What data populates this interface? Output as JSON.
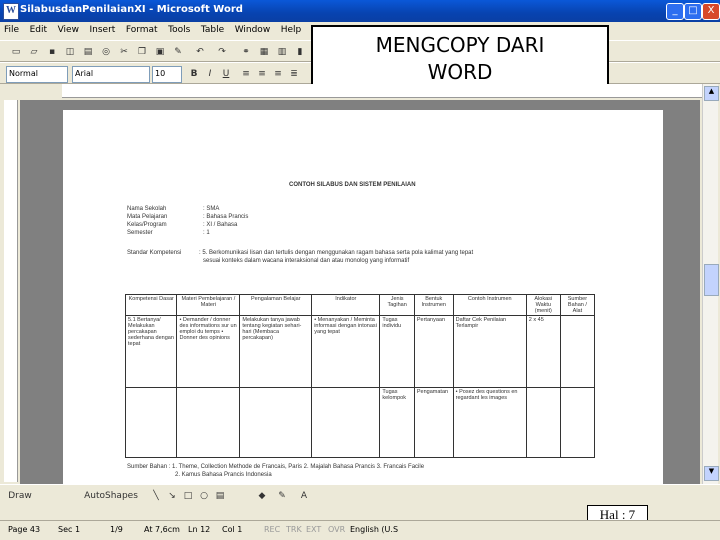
{
  "window": {
    "title": "SilabusdanPenilaianXI - Microsoft Word",
    "app_icon": "W"
  },
  "window_buttons": {
    "minimize": "_",
    "maximize": "□",
    "close": "X"
  },
  "menu": [
    "File",
    "Edit",
    "View",
    "Insert",
    "Format",
    "Tools",
    "Table",
    "Window",
    "Help"
  ],
  "formatting": {
    "style": "Normal",
    "font": "Arial",
    "size": "10",
    "bold": "B",
    "italic": "I",
    "underline": "U"
  },
  "callout": {
    "line1": "MENGCOPY DARI",
    "line2": "WORD"
  },
  "document": {
    "heading": "CONTOH SILABUS DAN SISTEM PENILAIAN",
    "meta": [
      {
        "label": "Nama Sekolah",
        "value": ": SMA"
      },
      {
        "label": "Mata Pelajaran",
        "value": ": Bahasa Prancis"
      },
      {
        "label": "Kelas/Program",
        "value": ": XI / Bahasa"
      },
      {
        "label": "Semester",
        "value": ": 1"
      }
    ],
    "sk_label": "Standar Kompetensi",
    "sk_text": ": 5. Berkomunikasi lisan dan tertulis dengan menggunakan ragam bahasa serta pola kalimat yang tepat",
    "sk_text2": "sesuai konteks dalam wacana interaksional dan atau monolog yang informatif",
    "columns": [
      "Kompetensi Dasar",
      "Materi Pembelajaran / Materi",
      "Pengalaman Belajar",
      "Indikator",
      "Jenis Tagihan",
      "Bentuk Instrumen",
      "Contoh Instrumen",
      "Alokasi Waktu (menit)",
      "Sumber Bahan / Alat"
    ],
    "row": {
      "kd": "5.1 Bertanya/ Melakukan percakapan sederhana dengan tepat",
      "materi": "• Demander / donner des informations sur un emploi du temps • Donner des opinions",
      "pengalaman": "Melakukan tanya jawab tentang kegiatan sehari-hari (Membaca percakapan)",
      "indikator": "• Menanyakan / Meminta informasi dengan intonasi yang tepat",
      "jenis": "Tugas individu",
      "bentuk": "Pertanyaan",
      "contoh": "Daftar Cek Penilaian Terlampir",
      "waktu": "2 x 45",
      "sumber": ""
    },
    "row2": {
      "jenis": "Tugas kelompok",
      "bentuk": "Pengamatan",
      "contoh": "• Posez des questions en regardant les images"
    },
    "footer_line1": "Sumber Bahan : 1. Theme, Collection Methode de Francais, Paris 2. Majalah Bahasa Prancis 3. Francais Facile",
    "footer_line2": "2. Kamus Bahasa Prancis Indonesia"
  },
  "drawing": {
    "draw": "Draw",
    "autoshapes": "AutoShapes"
  },
  "status": {
    "page": "Page 43",
    "sec": "Sec 1",
    "pages": "1/9",
    "at": "At 7,6cm",
    "ln": "Ln 12",
    "col": "Col 1",
    "rec": "REC",
    "trk": "TRK",
    "ext": "EXT",
    "ovr": "OVR",
    "lang": "English (U.S"
  },
  "hal": "Hal : 7",
  "colors": {
    "title_blue": "#0a58d8",
    "chrome": "#ece9d8",
    "doc_bg": "#808080"
  }
}
